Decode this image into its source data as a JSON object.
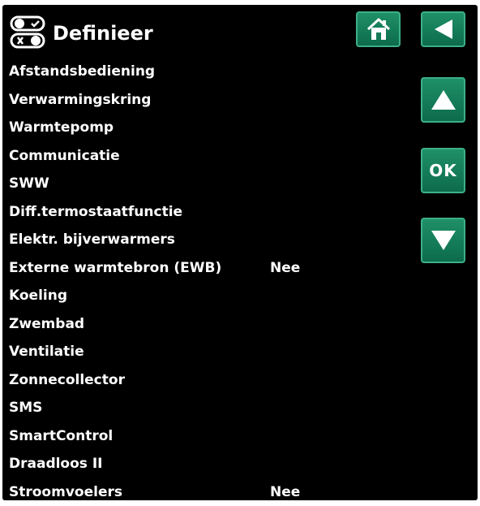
{
  "header": {
    "title": "Definieer",
    "icon": "toggle-switches-icon",
    "home_icon": "home-icon",
    "back_icon": "back-arrow-icon"
  },
  "side_buttons": {
    "up_icon": "arrow-up-icon",
    "ok_label": "OK",
    "down_icon": "arrow-down-icon"
  },
  "menu": {
    "items": [
      {
        "label": "Afstandsbediening",
        "value": ""
      },
      {
        "label": "Verwarmingskring",
        "value": ""
      },
      {
        "label": "Warmtepomp",
        "value": ""
      },
      {
        "label": "Communicatie",
        "value": ""
      },
      {
        "label": "SWW",
        "value": ""
      },
      {
        "label": "Diff.termostaatfunctie",
        "value": ""
      },
      {
        "label": "Elektr. bijverwarmers",
        "value": ""
      },
      {
        "label": "Externe warmtebron (EWB)",
        "value": "Nee"
      },
      {
        "label": "Koeling",
        "value": ""
      },
      {
        "label": "Zwembad",
        "value": ""
      },
      {
        "label": "Ventilatie",
        "value": ""
      },
      {
        "label": "Zonnecollector",
        "value": ""
      },
      {
        "label": "SMS",
        "value": ""
      },
      {
        "label": "SmartControl",
        "value": ""
      },
      {
        "label": "Draadloos II",
        "value": ""
      },
      {
        "label": "Stroomvoelers",
        "value": "Nee"
      }
    ]
  },
  "colors": {
    "background": "#000000",
    "text": "#ffffff",
    "button": "#137a57",
    "button_border": "#3db088"
  }
}
